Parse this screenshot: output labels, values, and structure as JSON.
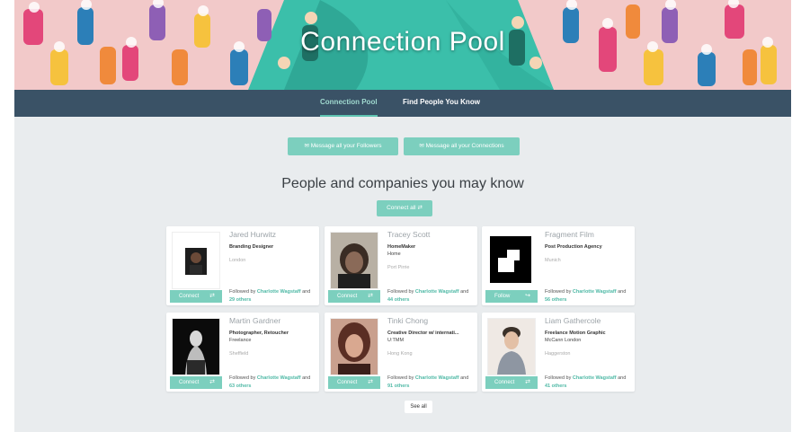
{
  "banner": {
    "title": "Connection Pool"
  },
  "nav": {
    "tabs": [
      {
        "label": "Connection Pool",
        "active": true
      },
      {
        "label": "Find People You Know",
        "active": false
      }
    ]
  },
  "actions": {
    "message_followers": "Message all your Followers",
    "message_connections": "Message all your Connections",
    "connect_all": "Connect all"
  },
  "section": {
    "heading": "People and companies you may know"
  },
  "cards": [
    {
      "name": "Jared Hurwitz",
      "title": "Branding Designer",
      "company": "",
      "location": "London",
      "button": "Connect",
      "followed_prefix": "Followed by",
      "followed_name": "Charlotte Wagstaff",
      "followed_and": "and",
      "followed_others": "29 others"
    },
    {
      "name": "Tracey Scott",
      "title": "HomeMaker",
      "company": "Home",
      "location": "Port Pirrie",
      "button": "Connect",
      "followed_prefix": "Followed by",
      "followed_name": "Charlotte Wagstaff",
      "followed_and": "and",
      "followed_others": "44 others"
    },
    {
      "name": "Fragment Film",
      "title": "Post Production Agency",
      "company": "",
      "location": "Munich",
      "button": "Follow",
      "followed_prefix": "Followed by",
      "followed_name": "Charlotte Wagstaff",
      "followed_and": "and",
      "followed_others": "56 others"
    },
    {
      "name": "Martin Gardner",
      "title": "Photographer, Retoucher",
      "company": "Freelance",
      "location": "Sheffield",
      "button": "Connect",
      "followed_prefix": "Followed by",
      "followed_name": "Charlotte Wagstaff",
      "followed_and": "and",
      "followed_others": "63 others"
    },
    {
      "name": "Tinki Chong",
      "title": "Creative Director w/ internati...",
      "company": "U:TMM",
      "location": "Hong Kong",
      "button": "Connect",
      "followed_prefix": "Followed by",
      "followed_name": "Charlotte Wagstaff",
      "followed_and": "and",
      "followed_others": "91 others"
    },
    {
      "name": "Liam Gathercole",
      "title": "Freelance Motion Graphic",
      "company": "McCann London",
      "location": "Haggerston",
      "button": "Connect",
      "followed_prefix": "Followed by",
      "followed_name": "Charlotte Wagstaff",
      "followed_and": "and",
      "followed_others": "41 others"
    }
  ],
  "footer": {
    "see_all": "See all"
  },
  "colors": {
    "accent": "#7ccfbe",
    "nav_bg": "#3a5266",
    "page_bg": "#e9ecee"
  },
  "icons": {
    "message": "speech-bubble-icon",
    "connect": "swap-arrows-icon",
    "follow": "follow-arrow-icon"
  }
}
